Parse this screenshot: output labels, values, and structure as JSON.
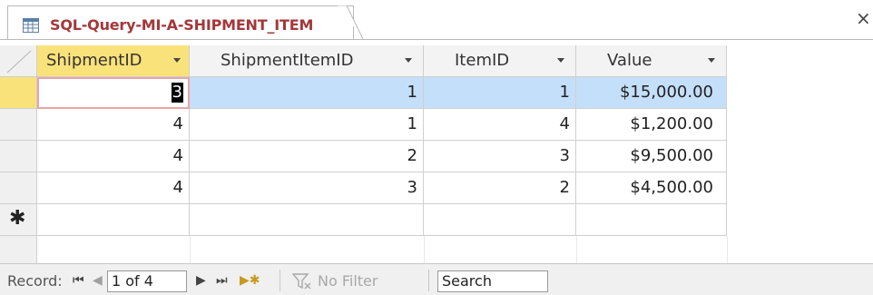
{
  "tab": {
    "title": "SQL-Query-MI-A-SHIPMENT_ITEM",
    "icon": "query-datasheet-icon",
    "close_glyph": "×"
  },
  "columns": [
    {
      "label": "ShipmentID",
      "sorted": true
    },
    {
      "label": "ShipmentItemID"
    },
    {
      "label": "ItemID"
    },
    {
      "label": "Value"
    }
  ],
  "rows": [
    {
      "ShipmentID": "3",
      "ShipmentItemID": "1",
      "ItemID": "1",
      "Value": "$15,000.00"
    },
    {
      "ShipmentID": "4",
      "ShipmentItemID": "1",
      "ItemID": "4",
      "Value": "$1,200.00"
    },
    {
      "ShipmentID": "4",
      "ShipmentItemID": "2",
      "ItemID": "3",
      "Value": "$9,500.00"
    },
    {
      "ShipmentID": "4",
      "ShipmentItemID": "3",
      "ItemID": "2",
      "Value": "$4,500.00"
    }
  ],
  "new_record_marker": "✱",
  "status": {
    "record_label": "Record:",
    "first": "⏮",
    "prev": "◀",
    "position": "1 of 4",
    "next": "▶",
    "last": "⏭",
    "new": "▶✱",
    "filter_label": "No Filter",
    "search_placeholder": "Search"
  },
  "colors": {
    "tab_title": "#a4373a",
    "active_header": "#f9e27a",
    "selected_row": "#c4dff9",
    "current_cell_outline": "#e7a6a6"
  }
}
